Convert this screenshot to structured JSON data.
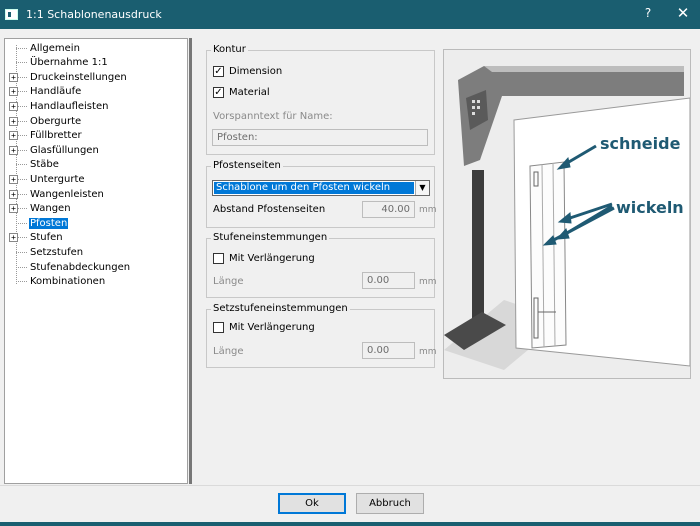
{
  "window": {
    "title": "1:1 Schablonenausdruck",
    "help_label": "?",
    "close_label": "✕"
  },
  "tree": {
    "items": [
      {
        "label": "Allgemein",
        "expandable": false
      },
      {
        "label": "Übernahme 1:1",
        "expandable": false
      },
      {
        "label": "Druckeinstellungen",
        "expandable": true
      },
      {
        "label": "Handläufe",
        "expandable": true
      },
      {
        "label": "Handlaufleisten",
        "expandable": true
      },
      {
        "label": "Obergurte",
        "expandable": true
      },
      {
        "label": "Füllbretter",
        "expandable": true
      },
      {
        "label": "Glasfüllungen",
        "expandable": true
      },
      {
        "label": "Stäbe",
        "expandable": false
      },
      {
        "label": "Untergurte",
        "expandable": true
      },
      {
        "label": "Wangenleisten",
        "expandable": true
      },
      {
        "label": "Wangen",
        "expandable": true
      },
      {
        "label": "Pfosten",
        "expandable": false,
        "selected": true
      },
      {
        "label": "Stufen",
        "expandable": true
      },
      {
        "label": "Setzstufen",
        "expandable": false
      },
      {
        "label": "Stufenabdeckungen",
        "expandable": false
      },
      {
        "label": "Kombinationen",
        "expandable": false
      }
    ],
    "expander_symbol": "+"
  },
  "kontur": {
    "title": "Kontur",
    "dimension_label": "Dimension",
    "dimension_checked": true,
    "material_label": "Material",
    "material_checked": true,
    "vorspann_label": "Vorspanntext für Name:",
    "vorspann_value": "Pfosten:"
  },
  "pfostenseiten": {
    "title": "Pfostenseiten",
    "select_value": "Schablone um den Pfosten wickeln",
    "abstand_label": "Abstand Pfostenseiten",
    "abstand_value": "40.00",
    "unit": "mm"
  },
  "stufeneinstemmungen": {
    "title": "Stufeneinstemmungen",
    "verlaengerung_label": "Mit Verlängerung",
    "verlaengerung_checked": false,
    "laenge_label": "Länge",
    "laenge_value": "0.00",
    "unit": "mm"
  },
  "setzstufeneinstemmungen": {
    "title": "Setzstufeneinstemmungen",
    "verlaengerung_label": "Mit Verlängerung",
    "verlaengerung_checked": false,
    "laenge_label": "Länge",
    "laenge_value": "0.00",
    "unit": "mm"
  },
  "preview": {
    "annotation_cut": "schneide",
    "annotation_wrap": "wickeln",
    "annotation_color": "#1f5a73"
  },
  "buttons": {
    "ok_label": "Ok",
    "cancel_label": "Abbruch"
  },
  "colors": {
    "titlebar": "#1a5e70",
    "selection": "#0078d7"
  }
}
